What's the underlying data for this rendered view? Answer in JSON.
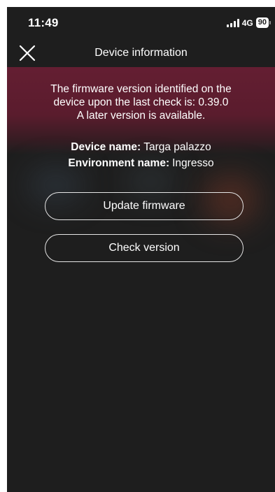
{
  "status_bar": {
    "time": "11:49",
    "network": "4G",
    "battery": "90"
  },
  "nav": {
    "title": "Device information",
    "close_icon": "close-icon"
  },
  "firmware": {
    "line1": "The firmware version identified on the",
    "line2": "device upon the last check is: 0.39.0",
    "line3": "A later version is available."
  },
  "device": {
    "name_label": "Device name:",
    "name_value": "Targa palazzo",
    "environment_label": "Environment name:",
    "environment_value": "Ingresso"
  },
  "actions": {
    "update_label": "Update firmware",
    "check_label": "Check version"
  },
  "colors": {
    "background": "#1e1e1e",
    "header_band": "#641e32",
    "text": "#ffffff",
    "button_border": "#e6e6e6"
  }
}
